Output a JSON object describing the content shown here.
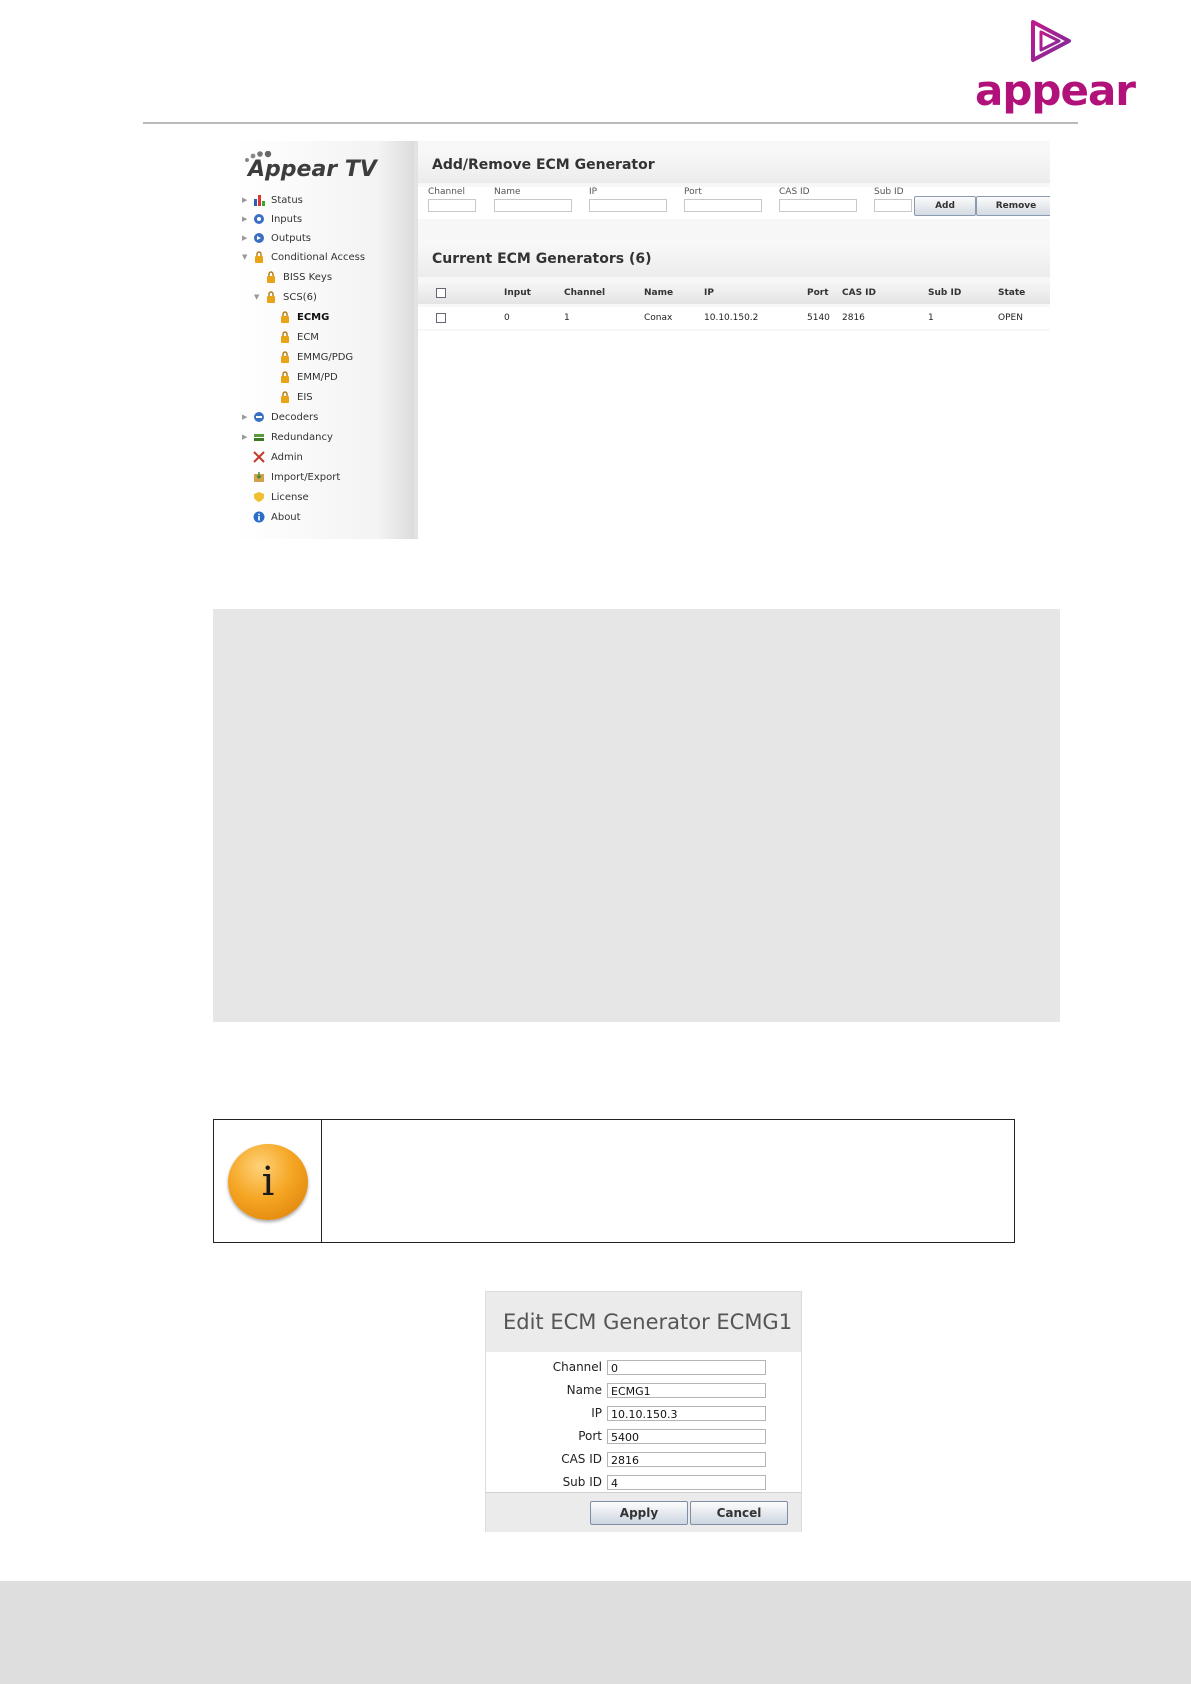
{
  "logo": {
    "wordmark": "appear"
  },
  "ui": {
    "brand": "Appear TV",
    "nav": [
      {
        "label": "Status"
      },
      {
        "label": "Inputs"
      },
      {
        "label": "Outputs"
      },
      {
        "label": "Conditional Access"
      },
      {
        "label": "BISS Keys"
      },
      {
        "label": "SCS(6)"
      },
      {
        "label": "ECMG"
      },
      {
        "label": "ECM"
      },
      {
        "label": "EMMG/PDG"
      },
      {
        "label": "EMM/PD"
      },
      {
        "label": "EIS"
      },
      {
        "label": "Decoders"
      },
      {
        "label": "Redundancy"
      },
      {
        "label": "Admin"
      },
      {
        "label": "Import/Export"
      },
      {
        "label": "License"
      },
      {
        "label": "About"
      }
    ],
    "add_section": {
      "title": "Add/Remove ECM Generator",
      "fields": [
        "Channel",
        "Name",
        "IP",
        "Port",
        "CAS ID",
        "Sub ID"
      ],
      "add_label": "Add",
      "remove_label": "Remove"
    },
    "current_section": {
      "title": "Current ECM Generators (6)",
      "columns": [
        "Input",
        "Channel",
        "Name",
        "IP",
        "Port",
        "CAS ID",
        "Sub ID",
        "State"
      ],
      "rows": [
        {
          "input": "0",
          "channel": "1",
          "name": "Conax",
          "ip": "10.10.150.2",
          "port": "5140",
          "cas_id": "2816",
          "sub_id": "1",
          "state": "OPEN"
        }
      ]
    }
  },
  "note": {
    "icon": "info-icon",
    "symbol": "i"
  },
  "dialog": {
    "title": "Edit ECM Generator ECMG1",
    "fields": [
      {
        "label": "Channel",
        "value": "0"
      },
      {
        "label": "Name",
        "value": "ECMG1"
      },
      {
        "label": "IP",
        "value": "10.10.150.3"
      },
      {
        "label": "Port",
        "value": "5400"
      },
      {
        "label": "CAS ID",
        "value": "2816"
      },
      {
        "label": "Sub ID",
        "value": "4"
      }
    ],
    "apply_label": "Apply",
    "cancel_label": "Cancel"
  },
  "colors": {
    "brand": "#b1127a",
    "info": "#f5a623",
    "grey_block": "#e6e6e6",
    "footer": "#dedede"
  }
}
